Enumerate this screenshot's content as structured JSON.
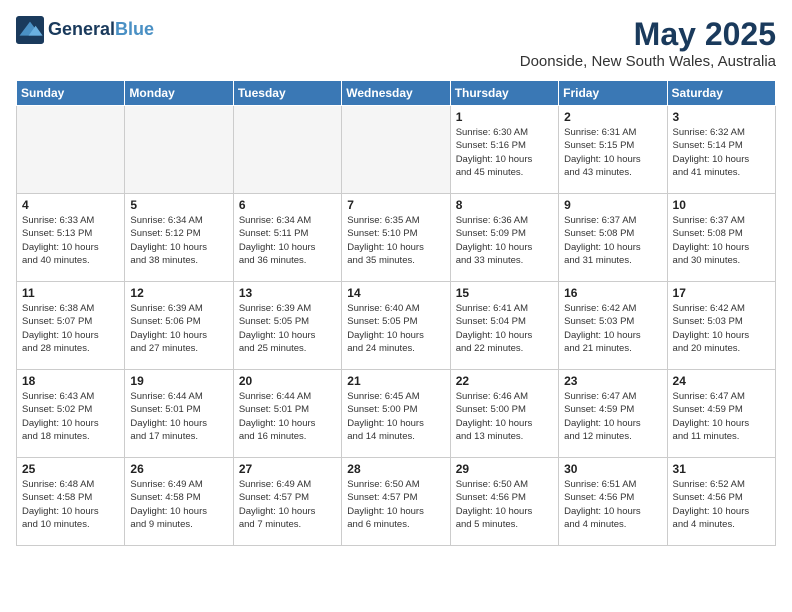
{
  "header": {
    "logo_line1": "General",
    "logo_line2": "Blue",
    "title": "May 2025",
    "subtitle": "Doonside, New South Wales, Australia"
  },
  "days_of_week": [
    "Sunday",
    "Monday",
    "Tuesday",
    "Wednesday",
    "Thursday",
    "Friday",
    "Saturday"
  ],
  "weeks": [
    [
      {
        "day": "",
        "info": "",
        "empty": true
      },
      {
        "day": "",
        "info": "",
        "empty": true
      },
      {
        "day": "",
        "info": "",
        "empty": true
      },
      {
        "day": "",
        "info": "",
        "empty": true
      },
      {
        "day": "1",
        "info": "Sunrise: 6:30 AM\nSunset: 5:16 PM\nDaylight: 10 hours\nand 45 minutes."
      },
      {
        "day": "2",
        "info": "Sunrise: 6:31 AM\nSunset: 5:15 PM\nDaylight: 10 hours\nand 43 minutes."
      },
      {
        "day": "3",
        "info": "Sunrise: 6:32 AM\nSunset: 5:14 PM\nDaylight: 10 hours\nand 41 minutes."
      }
    ],
    [
      {
        "day": "4",
        "info": "Sunrise: 6:33 AM\nSunset: 5:13 PM\nDaylight: 10 hours\nand 40 minutes."
      },
      {
        "day": "5",
        "info": "Sunrise: 6:34 AM\nSunset: 5:12 PM\nDaylight: 10 hours\nand 38 minutes."
      },
      {
        "day": "6",
        "info": "Sunrise: 6:34 AM\nSunset: 5:11 PM\nDaylight: 10 hours\nand 36 minutes."
      },
      {
        "day": "7",
        "info": "Sunrise: 6:35 AM\nSunset: 5:10 PM\nDaylight: 10 hours\nand 35 minutes."
      },
      {
        "day": "8",
        "info": "Sunrise: 6:36 AM\nSunset: 5:09 PM\nDaylight: 10 hours\nand 33 minutes."
      },
      {
        "day": "9",
        "info": "Sunrise: 6:37 AM\nSunset: 5:08 PM\nDaylight: 10 hours\nand 31 minutes."
      },
      {
        "day": "10",
        "info": "Sunrise: 6:37 AM\nSunset: 5:08 PM\nDaylight: 10 hours\nand 30 minutes."
      }
    ],
    [
      {
        "day": "11",
        "info": "Sunrise: 6:38 AM\nSunset: 5:07 PM\nDaylight: 10 hours\nand 28 minutes."
      },
      {
        "day": "12",
        "info": "Sunrise: 6:39 AM\nSunset: 5:06 PM\nDaylight: 10 hours\nand 27 minutes."
      },
      {
        "day": "13",
        "info": "Sunrise: 6:39 AM\nSunset: 5:05 PM\nDaylight: 10 hours\nand 25 minutes."
      },
      {
        "day": "14",
        "info": "Sunrise: 6:40 AM\nSunset: 5:05 PM\nDaylight: 10 hours\nand 24 minutes."
      },
      {
        "day": "15",
        "info": "Sunrise: 6:41 AM\nSunset: 5:04 PM\nDaylight: 10 hours\nand 22 minutes."
      },
      {
        "day": "16",
        "info": "Sunrise: 6:42 AM\nSunset: 5:03 PM\nDaylight: 10 hours\nand 21 minutes."
      },
      {
        "day": "17",
        "info": "Sunrise: 6:42 AM\nSunset: 5:03 PM\nDaylight: 10 hours\nand 20 minutes."
      }
    ],
    [
      {
        "day": "18",
        "info": "Sunrise: 6:43 AM\nSunset: 5:02 PM\nDaylight: 10 hours\nand 18 minutes."
      },
      {
        "day": "19",
        "info": "Sunrise: 6:44 AM\nSunset: 5:01 PM\nDaylight: 10 hours\nand 17 minutes."
      },
      {
        "day": "20",
        "info": "Sunrise: 6:44 AM\nSunset: 5:01 PM\nDaylight: 10 hours\nand 16 minutes."
      },
      {
        "day": "21",
        "info": "Sunrise: 6:45 AM\nSunset: 5:00 PM\nDaylight: 10 hours\nand 14 minutes."
      },
      {
        "day": "22",
        "info": "Sunrise: 6:46 AM\nSunset: 5:00 PM\nDaylight: 10 hours\nand 13 minutes."
      },
      {
        "day": "23",
        "info": "Sunrise: 6:47 AM\nSunset: 4:59 PM\nDaylight: 10 hours\nand 12 minutes."
      },
      {
        "day": "24",
        "info": "Sunrise: 6:47 AM\nSunset: 4:59 PM\nDaylight: 10 hours\nand 11 minutes."
      }
    ],
    [
      {
        "day": "25",
        "info": "Sunrise: 6:48 AM\nSunset: 4:58 PM\nDaylight: 10 hours\nand 10 minutes."
      },
      {
        "day": "26",
        "info": "Sunrise: 6:49 AM\nSunset: 4:58 PM\nDaylight: 10 hours\nand 9 minutes."
      },
      {
        "day": "27",
        "info": "Sunrise: 6:49 AM\nSunset: 4:57 PM\nDaylight: 10 hours\nand 7 minutes."
      },
      {
        "day": "28",
        "info": "Sunrise: 6:50 AM\nSunset: 4:57 PM\nDaylight: 10 hours\nand 6 minutes."
      },
      {
        "day": "29",
        "info": "Sunrise: 6:50 AM\nSunset: 4:56 PM\nDaylight: 10 hours\nand 5 minutes."
      },
      {
        "day": "30",
        "info": "Sunrise: 6:51 AM\nSunset: 4:56 PM\nDaylight: 10 hours\nand 4 minutes."
      },
      {
        "day": "31",
        "info": "Sunrise: 6:52 AM\nSunset: 4:56 PM\nDaylight: 10 hours\nand 4 minutes."
      }
    ]
  ]
}
